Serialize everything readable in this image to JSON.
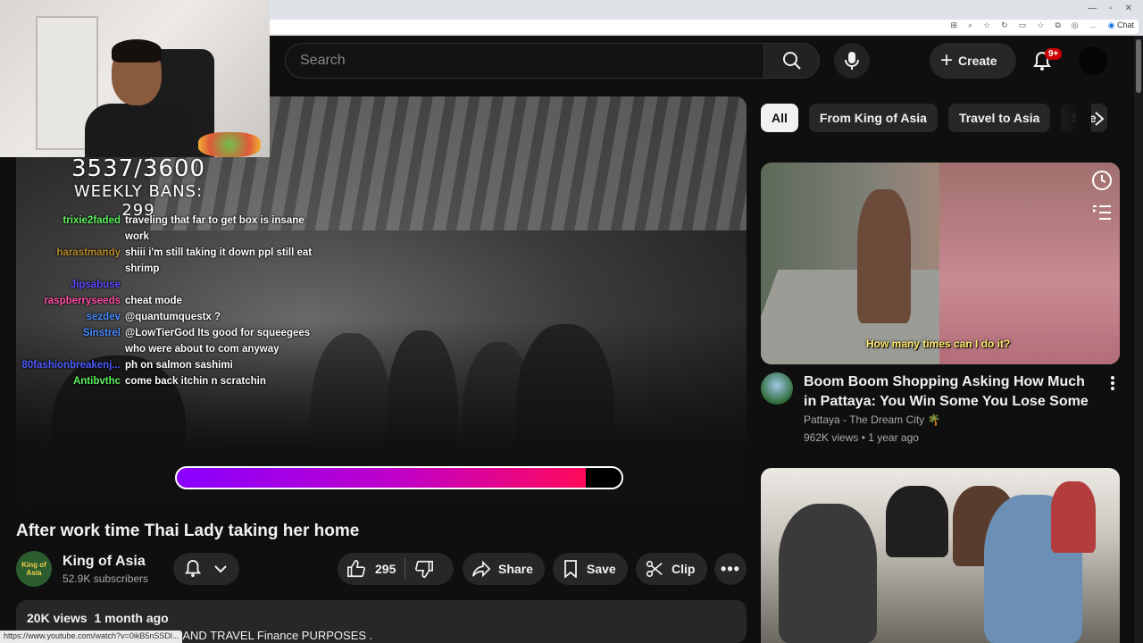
{
  "browser": {
    "chat_label": "Chat",
    "status_url": "https://www.youtube.com/watch?v=0ikB5nSSDl..."
  },
  "header": {
    "search_placeholder": "Search",
    "create_label": "Create",
    "notifications_badge": "9+"
  },
  "stream_overlay": {
    "counter": "3537/3600",
    "weekly_bans": "WEEKLY BANS: 299",
    "progress_fraction": 0.92,
    "chat": [
      {
        "user": "trixie2faded",
        "color": "#5cf25c",
        "text": "traveling that far to get box is insane work"
      },
      {
        "user": "harastmandy",
        "color": "#b58a2a",
        "text": "shiii i'm still taking it down ppl still eat shrimp"
      },
      {
        "user": "Jipsabuse",
        "color": "#5a4dff",
        "text": ""
      },
      {
        "user": "raspberryseeds",
        "color": "#ff4fa6",
        "text": "cheat mode"
      },
      {
        "user": "sezdev",
        "color": "#4a8cff",
        "text": "@quantumquestx ?"
      },
      {
        "user": "Sinstrel",
        "color": "#4a8cff",
        "text": "@LowTierGod Its good for squeegees who were about to com anyway"
      },
      {
        "user": "80fashionbreakenj...",
        "color": "#4d5cff",
        "text": "ph on salmon sashimi"
      },
      {
        "user": "Antibvthc",
        "color": "#5cf25c",
        "text": "come back itchin n scratchin"
      }
    ]
  },
  "video": {
    "title": "After work time Thai Lady taking her home",
    "channel_name": "King of Asia",
    "channel_avatar_text": "King of Asia",
    "subscribers": "52.9K subscribers",
    "likes": "295",
    "share_label": "Share",
    "save_label": "Save",
    "clip_label": "Clip",
    "views_date": "20K views  1 month ago",
    "description_line": "TIONAL AND TRAVEL Finance PURPOSES ."
  },
  "sidebar": {
    "chips": [
      "All",
      "From King of Asia",
      "Travel to Asia",
      "Stre"
    ],
    "videos": [
      {
        "title": "Boom Boom Shopping Asking How Much in Pattaya: You Win Some You Lose Some",
        "channel": "Pattaya - The Dream City 🌴",
        "meta": "962K views • 1 year ago",
        "caption": "How many times can I do it?"
      }
    ]
  },
  "colors": {
    "background": "#0f0f0f",
    "accent_red": "#cc0000",
    "progress_start": "#8a00ff",
    "progress_end": "#ff0a5a"
  }
}
